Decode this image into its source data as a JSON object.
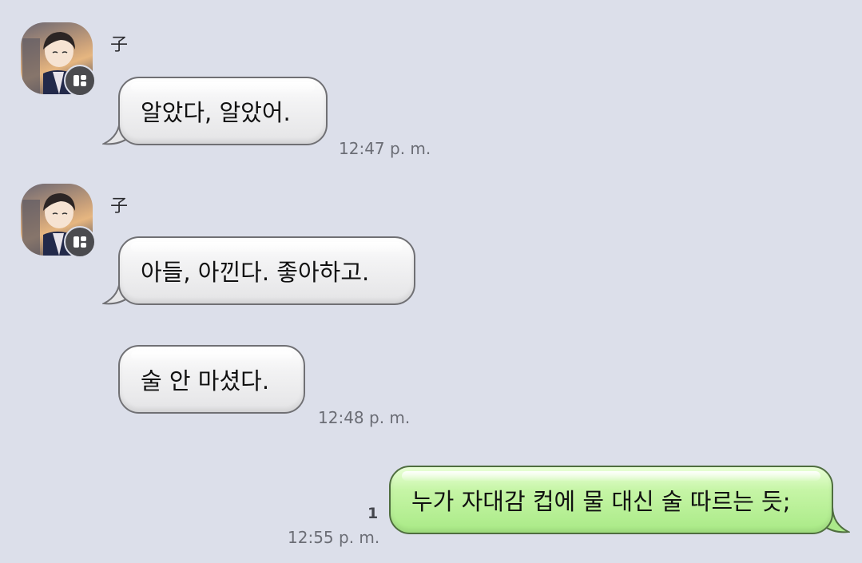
{
  "contact": {
    "name": "子"
  },
  "messages": [
    {
      "text": "알았다, 알았어.",
      "time": "12:47 p. m."
    },
    {
      "text": "아들, 아낀다. 좋아하고."
    },
    {
      "text": "술 안 마셨다.",
      "time": "12:48 p. m."
    },
    {
      "text": "누가 자대감 컵에 물 대신 술 따르는 듯;",
      "time": "12:55 p. m.",
      "read_count": "1"
    }
  ],
  "colors": {
    "background": "#dcdfea",
    "incoming_bubble": "#f2f2f3",
    "outgoing_bubble": "#b8f094",
    "badge": "#4b4b4f"
  },
  "icons": {
    "avatar_badge": "profile-badge-icon"
  }
}
